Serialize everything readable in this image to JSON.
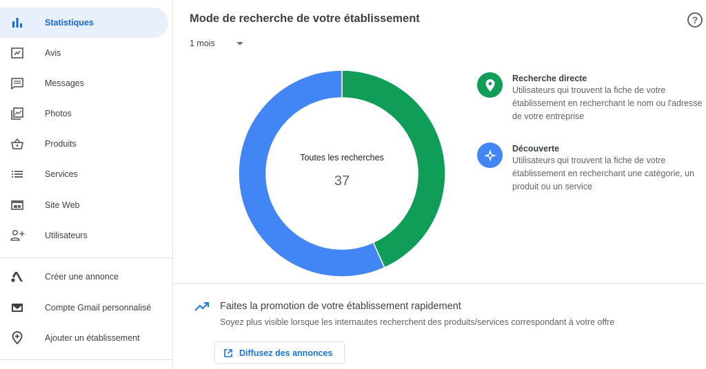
{
  "sidebar": {
    "items": [
      {
        "label": "Statistiques",
        "icon": "bar-chart-icon",
        "active": true
      },
      {
        "label": "Avis",
        "icon": "review-icon"
      },
      {
        "label": "Messages",
        "icon": "message-icon"
      },
      {
        "label": "Photos",
        "icon": "photos-icon"
      },
      {
        "label": "Produits",
        "icon": "basket-icon"
      },
      {
        "label": "Services",
        "icon": "list-icon"
      },
      {
        "label": "Site Web",
        "icon": "website-icon"
      },
      {
        "label": "Utilisateurs",
        "icon": "add-user-icon"
      }
    ],
    "secondary": [
      {
        "label": "Créer une annonce",
        "icon": "google-ads-icon"
      },
      {
        "label": "Compte Gmail personnalisé",
        "icon": "gmail-icon"
      },
      {
        "label": "Ajouter un établissement",
        "icon": "add-location-icon"
      }
    ]
  },
  "main": {
    "title": "Mode de recherche de votre établissement",
    "period": "1 mois",
    "chart": {
      "center_label": "Toutes les recherches",
      "total": "37"
    },
    "legend": [
      {
        "title": "Recherche directe",
        "description": "Utilisateurs qui trouvent la fiche de votre établissement en recherchant le nom ou l'adresse de votre entreprise",
        "color": "#0f9d58",
        "icon": "location-pin-icon"
      },
      {
        "title": "Découverte",
        "description": "Utilisateurs qui trouvent la fiche de votre établissement en recherchant une catégorie, un produit ou un service",
        "color": "#4285f4",
        "icon": "compass-icon"
      }
    ],
    "promo": {
      "title": "Faites la promotion de votre établissement rapidement",
      "description": "Soyez plus visible lorsque les internautes recherchent des produits/services correspondant à votre offre",
      "button": "Diffusez des annonces"
    }
  },
  "chart_data": {
    "type": "pie",
    "categories": [
      "Recherche directe",
      "Découverte"
    ],
    "values": [
      16,
      21
    ],
    "colors": [
      "#0f9d58",
      "#4285f4"
    ],
    "title": "Toutes les recherches",
    "total": 37
  }
}
